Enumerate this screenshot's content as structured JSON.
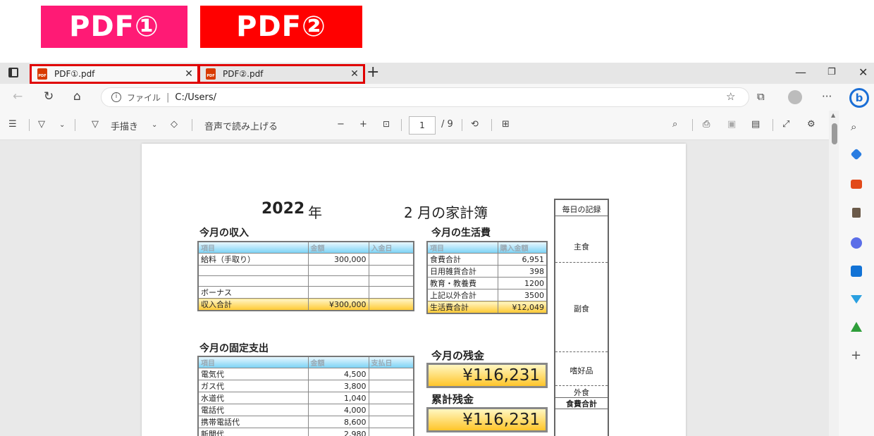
{
  "labels": {
    "pdf1": "PDF①",
    "pdf2": "PDF②"
  },
  "colors": {
    "label1": "#ff1a75",
    "label2": "#ff0000",
    "highlight": "#e00000"
  },
  "tabs": [
    {
      "title": "PDF①.pdf",
      "icon": "pdf-file-icon"
    },
    {
      "title": "PDF②.pdf",
      "icon": "pdf-file-icon"
    }
  ],
  "address": {
    "scheme_label": "ファイル",
    "url": "C:/Users/"
  },
  "toolbar": {
    "draw_label": "手描き",
    "read_aloud_label": "音声で読み上げる",
    "page_current": "1",
    "page_total": "/ 9"
  },
  "doc": {
    "year": "2022",
    "year_unit": "年",
    "month_title": "2 月の家計簿",
    "income": {
      "title": "今月の収入",
      "headers": [
        "項目",
        "金額",
        "入金日"
      ],
      "rows": [
        [
          "給料（手取り）",
          "300,000",
          ""
        ],
        [
          "",
          "",
          ""
        ],
        [
          "",
          "",
          ""
        ],
        [
          "ボーナス",
          "",
          ""
        ]
      ],
      "total": [
        "収入合計",
        "¥300,000",
        ""
      ]
    },
    "living": {
      "title": "今月の生活費",
      "headers": [
        "項目",
        "購入金額"
      ],
      "rows": [
        [
          "食費合計",
          "6,951"
        ],
        [
          "日用雑貨合計",
          "398"
        ],
        [
          "教育・教養費",
          "1200"
        ],
        [
          "上記以外合計",
          "3500"
        ]
      ],
      "total": [
        "生活費合計",
        "¥12,049"
      ]
    },
    "fixed": {
      "title": "今月の固定支出",
      "headers": [
        "項目",
        "金額",
        "支払日"
      ],
      "rows": [
        [
          "電気代",
          "4,500",
          ""
        ],
        [
          "ガス代",
          "3,800",
          ""
        ],
        [
          "水道代",
          "1,040",
          ""
        ],
        [
          "電話代",
          "4,000",
          ""
        ],
        [
          "携帯電話代",
          "8,600",
          ""
        ],
        [
          "新聞代",
          "2,980",
          ""
        ]
      ]
    },
    "balance": {
      "title": "今月の残金",
      "value": "¥116,231"
    },
    "cumulative": {
      "title": "累計残金",
      "value": "¥116,231"
    },
    "daily": {
      "title": "毎日の記録",
      "staple": "主食",
      "side": "副食",
      "luxury": "嗜好品",
      "eating_out": "外食",
      "food_total": "食費合計"
    }
  }
}
